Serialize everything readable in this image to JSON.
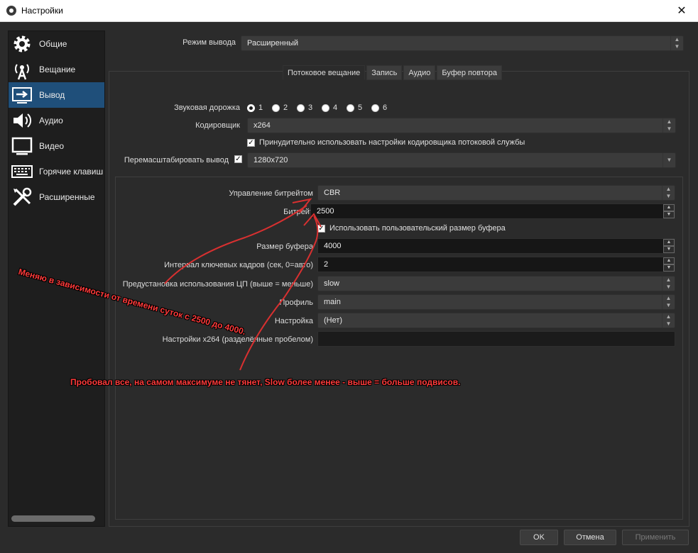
{
  "window": {
    "title": "Настройки",
    "close_glyph": "✕"
  },
  "sidebar": {
    "items": [
      {
        "label": "Общие",
        "icon": "gear-icon"
      },
      {
        "label": "Вещание",
        "icon": "broadcast-icon"
      },
      {
        "label": "Вывод",
        "icon": "output-icon",
        "active": true
      },
      {
        "label": "Аудио",
        "icon": "speaker-icon"
      },
      {
        "label": "Видео",
        "icon": "monitor-icon"
      },
      {
        "label": "Горячие клавиши",
        "icon": "keyboard-icon"
      },
      {
        "label": "Расширенные",
        "icon": "tools-icon"
      }
    ]
  },
  "output_mode": {
    "label": "Режим вывода",
    "value": "Расширенный"
  },
  "tabs": [
    "Потоковое вещание",
    "Запись",
    "Аудио",
    "Буфер повтора"
  ],
  "stream": {
    "audio_track_label": "Звуковая дорожка",
    "audio_tracks": [
      "1",
      "2",
      "3",
      "4",
      "5",
      "6"
    ],
    "encoder_label": "Кодировщик",
    "encoder_value": "x264",
    "enforce_label": "Принудительно использовать настройки кодировщика потоковой службы",
    "rescale_label": "Перемасштабировать вывод",
    "rescale_value": "1280x720"
  },
  "encoder_settings": {
    "rate_control_label": "Управление битрейтом",
    "rate_control_value": "CBR",
    "bitrate_label": "Битрейт",
    "bitrate_value": "2500",
    "custom_buffer_label": "Использовать пользовательский размер буфера",
    "buffer_label": "Размер буфера",
    "buffer_value": "4000",
    "keyint_label": "Интервал ключевых кадров (сек, 0=авто)",
    "keyint_value": "2",
    "preset_label": "Предустановка использования ЦП (выше = меньше)",
    "preset_value": "slow",
    "profile_label": "Профиль",
    "profile_value": "main",
    "tune_label": "Настройка",
    "tune_value": "(Нет)",
    "x264opts_label": "Настройки x264 (разделённые пробелом)",
    "x264opts_value": ""
  },
  "annotations": {
    "note1": "Меняю в зависимости от времени суток с 2500 до 4000.",
    "note2": "Пробовал все, на самом максимуме не тянет, Slow более менее - выше = больше подвисов."
  },
  "buttons": {
    "ok": "OK",
    "cancel": "Отмена",
    "apply": "Применить"
  },
  "colors": {
    "accent": "#1f4f7a",
    "annotation": "#ff3a3a"
  }
}
